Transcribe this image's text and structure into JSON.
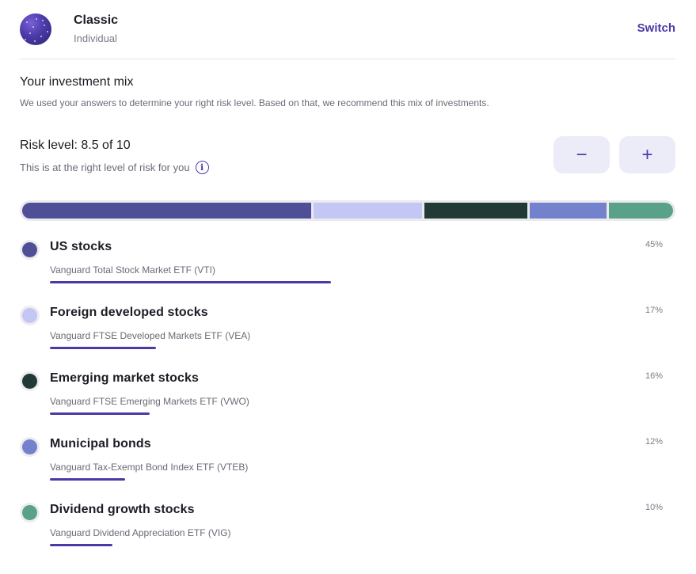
{
  "header": {
    "portfolio_name": "Classic",
    "portfolio_type": "Individual",
    "switch_label": "Switch"
  },
  "mix": {
    "title": "Your investment mix",
    "description": "We used your answers to determine your right risk level. Based on that, we recommend this mix of investments."
  },
  "risk": {
    "title": "Risk level: 8.5 of 10",
    "subtitle": "This is at the right level of risk for you",
    "info_glyph": "i",
    "minus_label": "−",
    "plus_label": "+"
  },
  "holdings": [
    {
      "name": "US stocks",
      "fund": "Vanguard Total Stock Market ETF (VTI)",
      "percent": "45%",
      "value": 45,
      "color": "#4f4f97"
    },
    {
      "name": "Foreign developed stocks",
      "fund": "Vanguard FTSE Developed Markets ETF (VEA)",
      "percent": "17%",
      "value": 17,
      "color": "#c4c6f4"
    },
    {
      "name": "Emerging market stocks",
      "fund": "Vanguard FTSE Emerging Markets ETF (VWO)",
      "percent": "16%",
      "value": 16,
      "color": "#213a35"
    },
    {
      "name": "Municipal bonds",
      "fund": "Vanguard Tax-Exempt Bond Index ETF (VTEB)",
      "percent": "12%",
      "value": 12,
      "color": "#7482cd"
    },
    {
      "name": "Dividend growth stocks",
      "fund": "Vanguard Dividend Appreciation ETF (VIG)",
      "percent": "10%",
      "value": 10,
      "color": "#5aa18a"
    }
  ],
  "colors": {
    "accent": "#4a3aa8"
  }
}
